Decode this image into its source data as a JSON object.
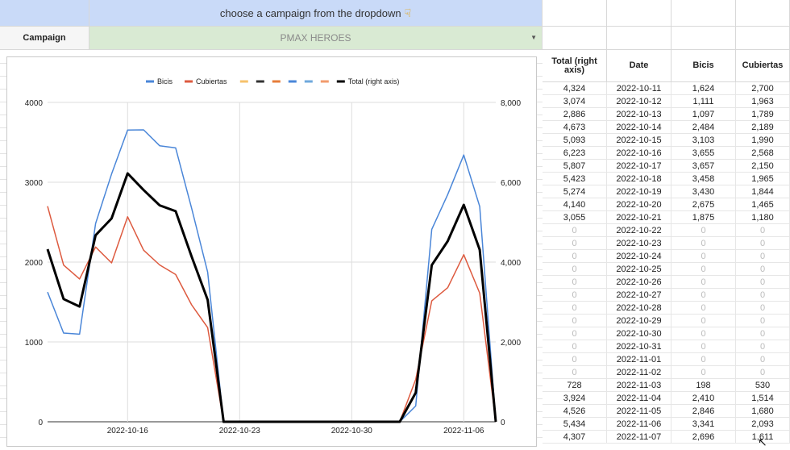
{
  "sheet": {
    "banner_text": "choose a campaign from the dropdown",
    "campaign_label": "Campaign",
    "campaign_value": "PMAX HEROES"
  },
  "table": {
    "headers": [
      "Total (right axis)",
      "Date",
      "Bicis",
      "Cubiertas"
    ],
    "rows": [
      [
        "4,324",
        "2022-10-11",
        "1,624",
        "2,700"
      ],
      [
        "3,074",
        "2022-10-12",
        "1,111",
        "1,963"
      ],
      [
        "2,886",
        "2022-10-13",
        "1,097",
        "1,789"
      ],
      [
        "4,673",
        "2022-10-14",
        "2,484",
        "2,189"
      ],
      [
        "5,093",
        "2022-10-15",
        "3,103",
        "1,990"
      ],
      [
        "6,223",
        "2022-10-16",
        "3,655",
        "2,568"
      ],
      [
        "5,807",
        "2022-10-17",
        "3,657",
        "2,150"
      ],
      [
        "5,423",
        "2022-10-18",
        "3,458",
        "1,965"
      ],
      [
        "5,274",
        "2022-10-19",
        "3,430",
        "1,844"
      ],
      [
        "4,140",
        "2022-10-20",
        "2,675",
        "1,465"
      ],
      [
        "3,055",
        "2022-10-21",
        "1,875",
        "1,180"
      ],
      [
        "0",
        "2022-10-22",
        "0",
        "0"
      ],
      [
        "0",
        "2022-10-23",
        "0",
        "0"
      ],
      [
        "0",
        "2022-10-24",
        "0",
        "0"
      ],
      [
        "0",
        "2022-10-25",
        "0",
        "0"
      ],
      [
        "0",
        "2022-10-26",
        "0",
        "0"
      ],
      [
        "0",
        "2022-10-27",
        "0",
        "0"
      ],
      [
        "0",
        "2022-10-28",
        "0",
        "0"
      ],
      [
        "0",
        "2022-10-29",
        "0",
        "0"
      ],
      [
        "0",
        "2022-10-30",
        "0",
        "0"
      ],
      [
        "0",
        "2022-10-31",
        "0",
        "0"
      ],
      [
        "0",
        "2022-11-01",
        "0",
        "0"
      ],
      [
        "0",
        "2022-11-02",
        "0",
        "0"
      ],
      [
        "728",
        "2022-11-03",
        "198",
        "530"
      ],
      [
        "3,924",
        "2022-11-04",
        "2,410",
        "1,514"
      ],
      [
        "4,526",
        "2022-11-05",
        "2,846",
        "1,680"
      ],
      [
        "5,434",
        "2022-11-06",
        "3,341",
        "2,093"
      ],
      [
        "4,307",
        "2022-11-07",
        "2,696",
        "1,611"
      ]
    ]
  },
  "chart_data": {
    "type": "line",
    "x": [
      "2022-10-11",
      "2022-10-12",
      "2022-10-13",
      "2022-10-14",
      "2022-10-15",
      "2022-10-16",
      "2022-10-17",
      "2022-10-18",
      "2022-10-19",
      "2022-10-20",
      "2022-10-21",
      "2022-10-22",
      "2022-10-23",
      "2022-10-24",
      "2022-10-25",
      "2022-10-26",
      "2022-10-27",
      "2022-10-28",
      "2022-10-29",
      "2022-10-30",
      "2022-10-31",
      "2022-11-01",
      "2022-11-02",
      "2022-11-03",
      "2022-11-04",
      "2022-11-05",
      "2022-11-06",
      "2022-11-07",
      "2022-11-08"
    ],
    "x_ticks": [
      "2022-10-16",
      "2022-10-23",
      "2022-10-30",
      "2022-11-06"
    ],
    "y_left_ticks": [
      0,
      1000,
      2000,
      3000,
      4000
    ],
    "y_right_ticks": [
      "0",
      "2,000",
      "4,000",
      "6,000",
      "8,000"
    ],
    "ylim_left": [
      0,
      4000
    ],
    "ylim_right": [
      0,
      8000
    ],
    "legend_position": "top",
    "legend": [
      {
        "name": "Bicis",
        "color": "#4a86d8"
      },
      {
        "name": "Cubiertas",
        "color": "#dd5a3f"
      },
      {
        "name": "",
        "color": "#f6c26b"
      },
      {
        "name": "",
        "color": "#333333"
      },
      {
        "name": "",
        "color": "#e67c3a"
      },
      {
        "name": "",
        "color": "#4a86d8"
      },
      {
        "name": "",
        "color": "#6fa8dc"
      },
      {
        "name": "",
        "color": "#f29b6d"
      },
      {
        "name": "Total (right axis)",
        "color": "#000000"
      }
    ],
    "series": [
      {
        "name": "Bicis",
        "axis": "left",
        "color": "#4a86d8",
        "values": [
          1624,
          1111,
          1097,
          2484,
          3103,
          3655,
          3657,
          3458,
          3430,
          2675,
          1875,
          0,
          0,
          0,
          0,
          0,
          0,
          0,
          0,
          0,
          0,
          0,
          0,
          198,
          2410,
          2846,
          3341,
          2696,
          0
        ]
      },
      {
        "name": "Cubiertas",
        "axis": "left",
        "color": "#dd5a3f",
        "values": [
          2700,
          1963,
          1789,
          2189,
          1990,
          2568,
          2150,
          1965,
          1844,
          1465,
          1180,
          0,
          0,
          0,
          0,
          0,
          0,
          0,
          0,
          0,
          0,
          0,
          0,
          530,
          1514,
          1680,
          2093,
          1611,
          0
        ]
      },
      {
        "name": "Total (right axis)",
        "axis": "right",
        "color": "#000000",
        "values": [
          4324,
          3074,
          2886,
          4673,
          5093,
          6223,
          5807,
          5423,
          5274,
          4140,
          3055,
          0,
          0,
          0,
          0,
          0,
          0,
          0,
          0,
          0,
          0,
          0,
          0,
          728,
          3924,
          4526,
          5434,
          4307,
          0
        ]
      }
    ]
  }
}
